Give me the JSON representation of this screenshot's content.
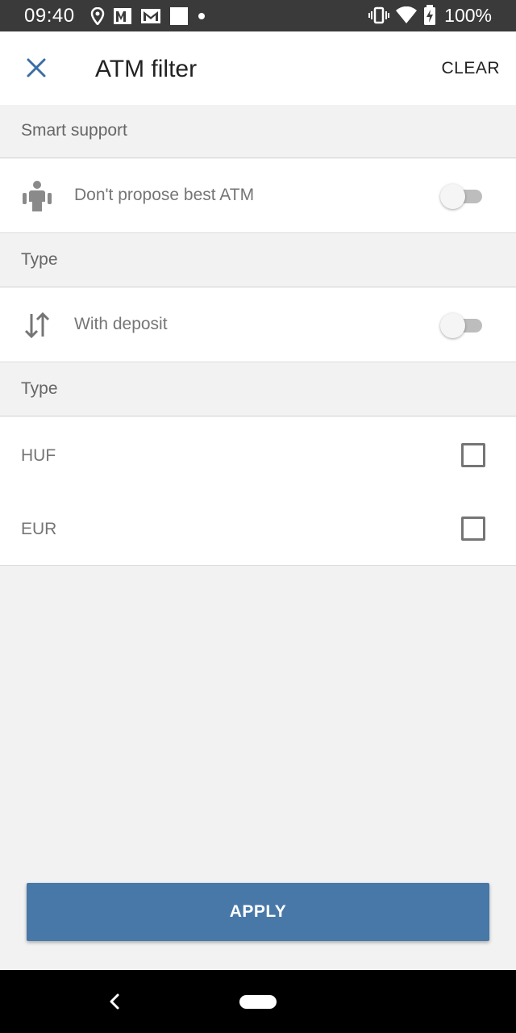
{
  "status_bar": {
    "time": "09:40",
    "battery": "100%",
    "icons": [
      "location-icon",
      "photos-icon",
      "gmail-icon",
      "square-icon",
      "dot-icon",
      "vibrate-icon",
      "wifi-icon",
      "battery-charging-icon"
    ]
  },
  "app_bar": {
    "title": "ATM filter",
    "clear_label": "CLEAR",
    "close_icon": "close-icon"
  },
  "sections": {
    "smart_support": {
      "header": "Smart support",
      "option_label": "Don't propose best ATM",
      "option_icon": "person-icon",
      "enabled": false
    },
    "type_deposit": {
      "header": "Type",
      "option_label": "With deposit",
      "option_icon": "swap-vertical-icon",
      "enabled": false
    },
    "type_currency": {
      "header": "Type",
      "options": [
        {
          "label": "HUF",
          "checked": false
        },
        {
          "label": "EUR",
          "checked": false
        }
      ]
    }
  },
  "apply_label": "APPLY",
  "colors": {
    "accent": "#4878a8",
    "background": "#f2f2f2",
    "close_icon": "#3a6ea5"
  }
}
